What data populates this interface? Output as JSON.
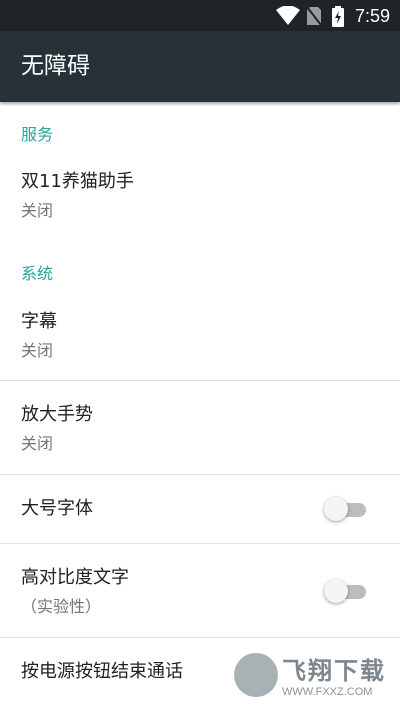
{
  "status_bar": {
    "time": "7:59",
    "icons": [
      "wifi-icon",
      "no-sim-icon",
      "battery-charging-icon"
    ]
  },
  "toolbar": {
    "title": "无障碍"
  },
  "sections": {
    "services": {
      "title": "服务",
      "items": [
        {
          "title": "双11养猫助手",
          "summary": "关闭"
        }
      ]
    },
    "system": {
      "title": "系统",
      "items": [
        {
          "title": "字幕",
          "summary": "关闭"
        },
        {
          "title": "放大手势",
          "summary": "关闭"
        },
        {
          "title": "大号字体",
          "switch": "off"
        },
        {
          "title": "高对比度文字",
          "summary": "（实验性）",
          "switch": "off"
        },
        {
          "title": "按电源按钮结束通话"
        }
      ]
    }
  },
  "watermark": {
    "text": "飞翔下载",
    "url": "WWW.FXXZ.COM"
  },
  "colors": {
    "toolbar": "#263238",
    "status_bar": "#1e2427",
    "accent": "#26a69a"
  }
}
